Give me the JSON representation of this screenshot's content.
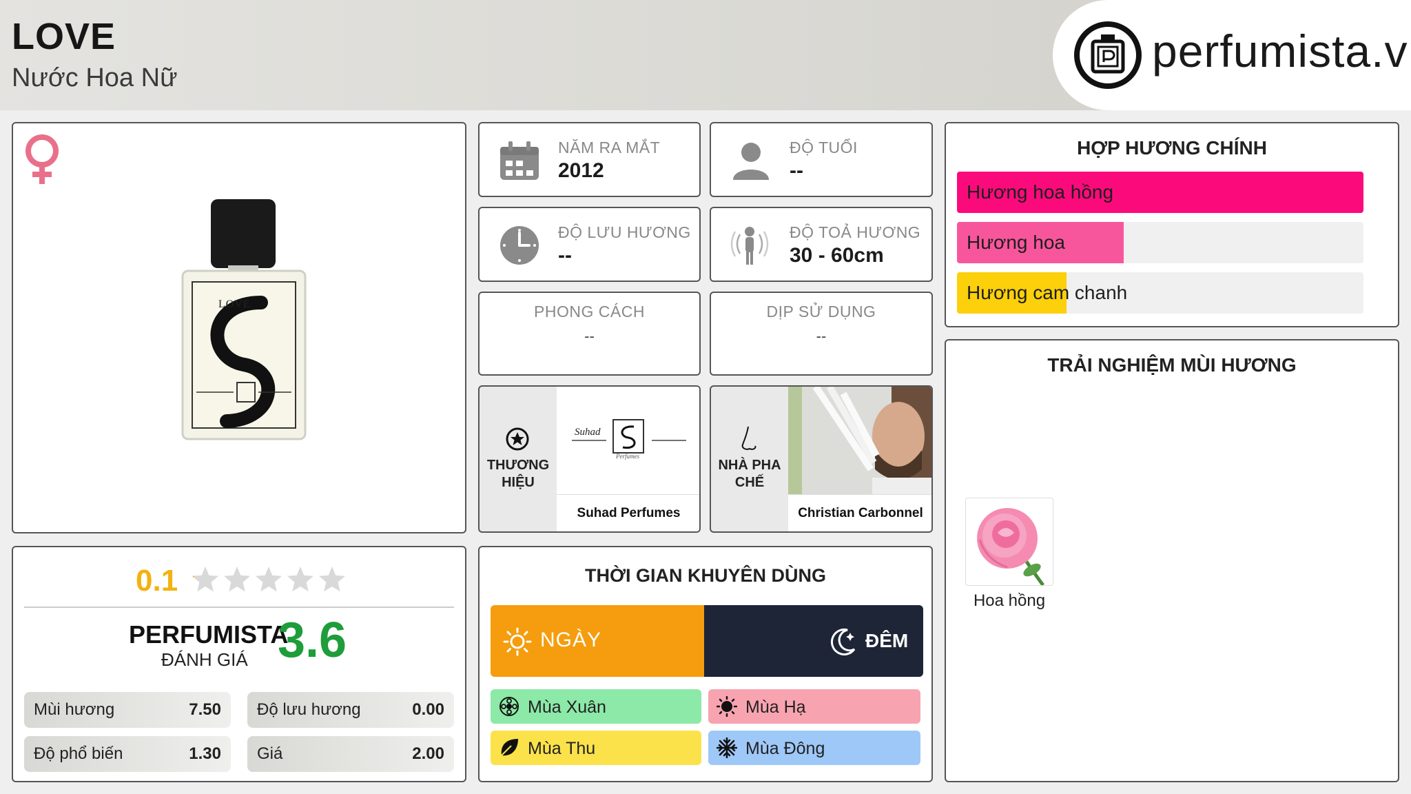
{
  "product": {
    "name": "LOVE",
    "category": "Nước Hoa Nữ"
  },
  "brand_site": "perfumista.vn",
  "stats": {
    "launch_year": {
      "label": "NĂM RA MẮT",
      "value": "2012"
    },
    "age": {
      "label": "ĐỘ TUỔI",
      "value": "--"
    },
    "longevity": {
      "label": "ĐỘ LƯU HƯƠNG",
      "value": "--"
    },
    "sillage": {
      "label": "ĐỘ TOẢ HƯƠNG",
      "value": "30 - 60cm"
    },
    "style": {
      "label": "PHONG CÁCH",
      "value": "--"
    },
    "occasion": {
      "label": "DỊP SỬ DỤNG",
      "value": "--"
    }
  },
  "brand": {
    "label": "THƯƠNG HIỆU",
    "name": "Suhad Perfumes",
    "logo_text": "Suhad",
    "logo_sub": "Perfumes"
  },
  "perfumer": {
    "label": "NHÀ PHA CHẾ",
    "name": "Christian Carbonnel"
  },
  "accords": {
    "title": "HỢP HƯƠNG CHÍNH",
    "items": [
      {
        "name": "Hương hoa hồng",
        "level": 1.0,
        "color": "#fb0a7b"
      },
      {
        "name": "Hương hoa",
        "level": 0.41,
        "color": "#f8569c"
      },
      {
        "name": "Hương cam chanh",
        "level": 0.27,
        "color": "#fcd00a"
      }
    ]
  },
  "experience": {
    "title": "TRẢI NGHIỆM MÙI HƯƠNG",
    "notes": [
      {
        "name": "Hoa hồng"
      }
    ]
  },
  "rating": {
    "user_score": "0.1",
    "stars_max": 5,
    "stars_filled": 0.02,
    "perfumista_label": "PERFUMISTA",
    "perfumista_sub": "ĐÁNH GIÁ",
    "perfumista_score": "3.6",
    "scores": [
      {
        "label": "Mùi hương",
        "value": "7.50"
      },
      {
        "label": "Độ lưu hương",
        "value": "0.00"
      },
      {
        "label": "Độ phổ biến",
        "value": "1.30"
      },
      {
        "label": "Giá",
        "value": "2.00"
      }
    ]
  },
  "usage": {
    "title": "THỜI GIAN KHUYÊN DÙNG",
    "day_label": "NGÀY",
    "night_label": "ĐÊM",
    "day_color": "#f59d0e",
    "night_color": "#1e2537",
    "seasons": [
      {
        "label": "Mùa Xuân",
        "color": "#8ce9a8",
        "icon": "flower-icon"
      },
      {
        "label": "Mùa Hạ",
        "color": "#f8a4b0",
        "icon": "sun-icon"
      },
      {
        "label": "Mùa Thu",
        "color": "#fbe24b",
        "icon": "leaf-icon"
      },
      {
        "label": "Mùa Đông",
        "color": "#9ec8f8",
        "icon": "snowflake-icon"
      }
    ]
  },
  "bottle_label": "LOVE"
}
